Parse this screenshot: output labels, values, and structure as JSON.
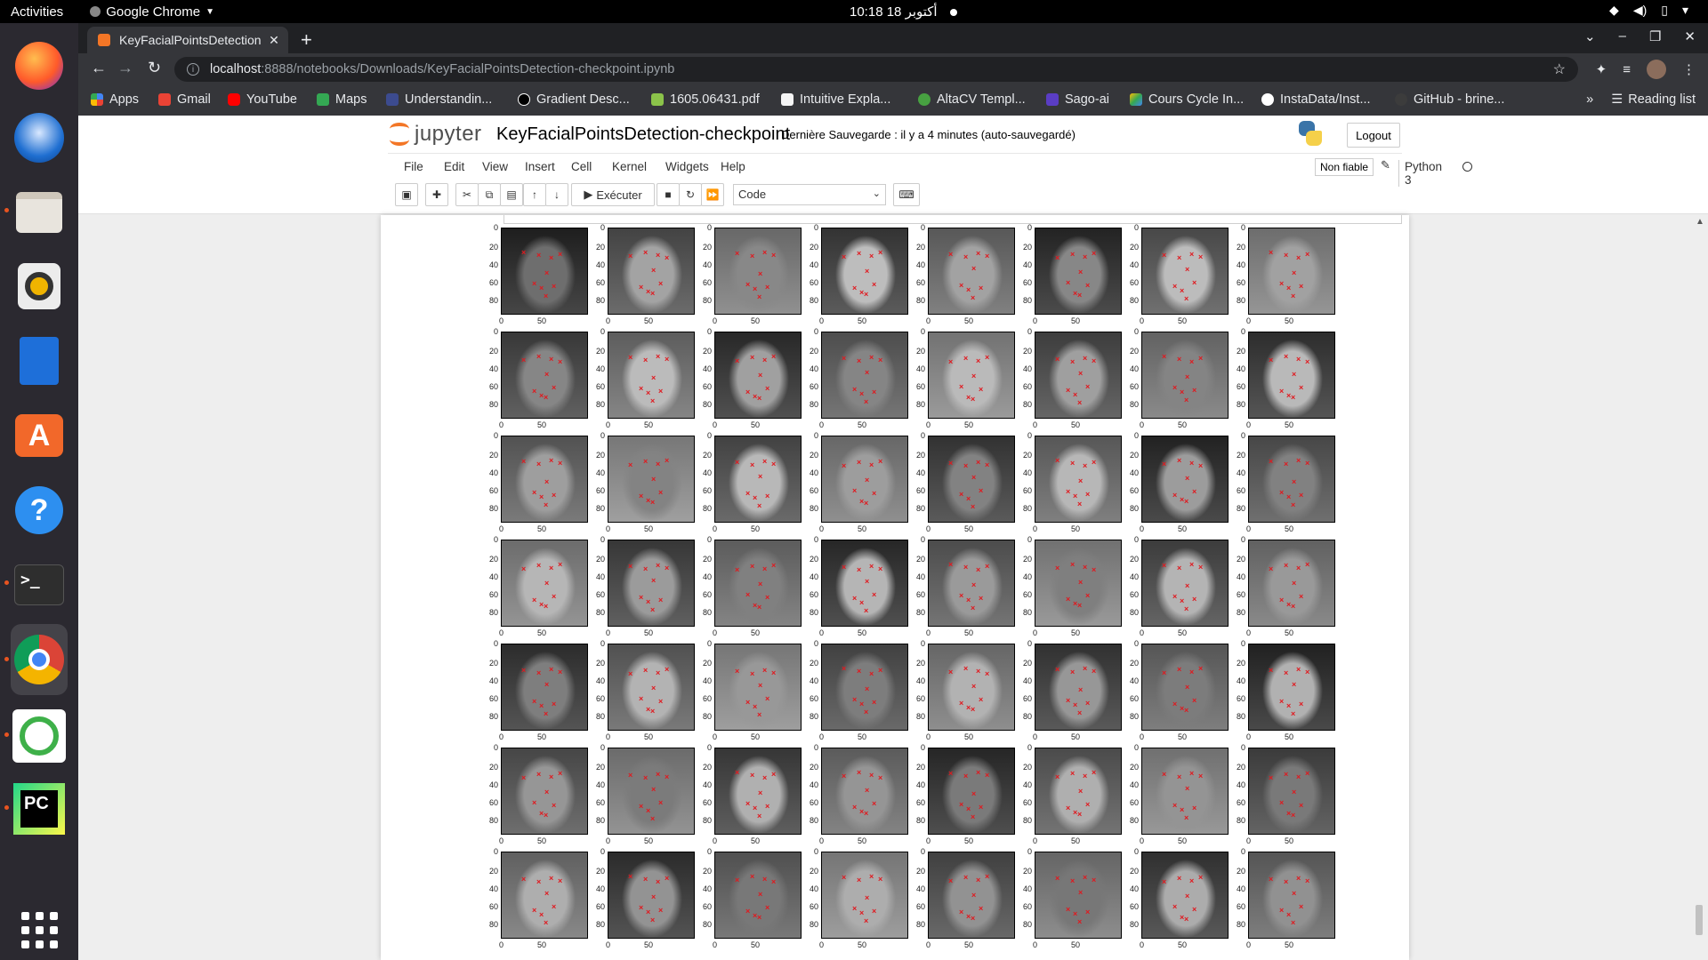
{
  "system": {
    "activities": "Activities",
    "app_name": "Google Chrome",
    "clock": "10:18  18 أكتوبر"
  },
  "browser": {
    "tab_title": "KeyFacialPointsDetection",
    "url_host": "localhost",
    "url_path": ":8888/notebooks/Downloads/KeyFacialPointsDetection-checkpoint.ipynb",
    "bookmarks": [
      "Apps",
      "Gmail",
      "YouTube",
      "Maps",
      "Understandin...",
      "Gradient Desc...",
      "1605.06431.pdf",
      "Intuitive Expla...",
      "AltaCV Templ...",
      "Sago-ai",
      "Cours Cycle In...",
      "InstaData/Inst...",
      "GitHub - brine..."
    ],
    "reading_list": "Reading list"
  },
  "jupyter": {
    "logo_text": "jupyter",
    "notebook_name": "KeyFacialPointsDetection-checkpoint",
    "save_status": "Dernière Sauvegarde : il y a 4 minutes   (auto-sauvegardé)",
    "logout": "Logout",
    "menu": [
      "File",
      "Edit",
      "View",
      "Insert",
      "Cell",
      "Kernel",
      "Widgets",
      "Help"
    ],
    "trusted": "Non fiable",
    "kernel": "Python 3",
    "run_label": "Exécuter",
    "cell_type": "Code"
  },
  "plot_grid": {
    "rows": 7,
    "cols": 8,
    "y_ticks": [
      "0",
      "20",
      "40",
      "60",
      "80"
    ],
    "x_ticks": [
      "0",
      "50"
    ],
    "marker": "×",
    "marker_color": "#e0191f"
  }
}
